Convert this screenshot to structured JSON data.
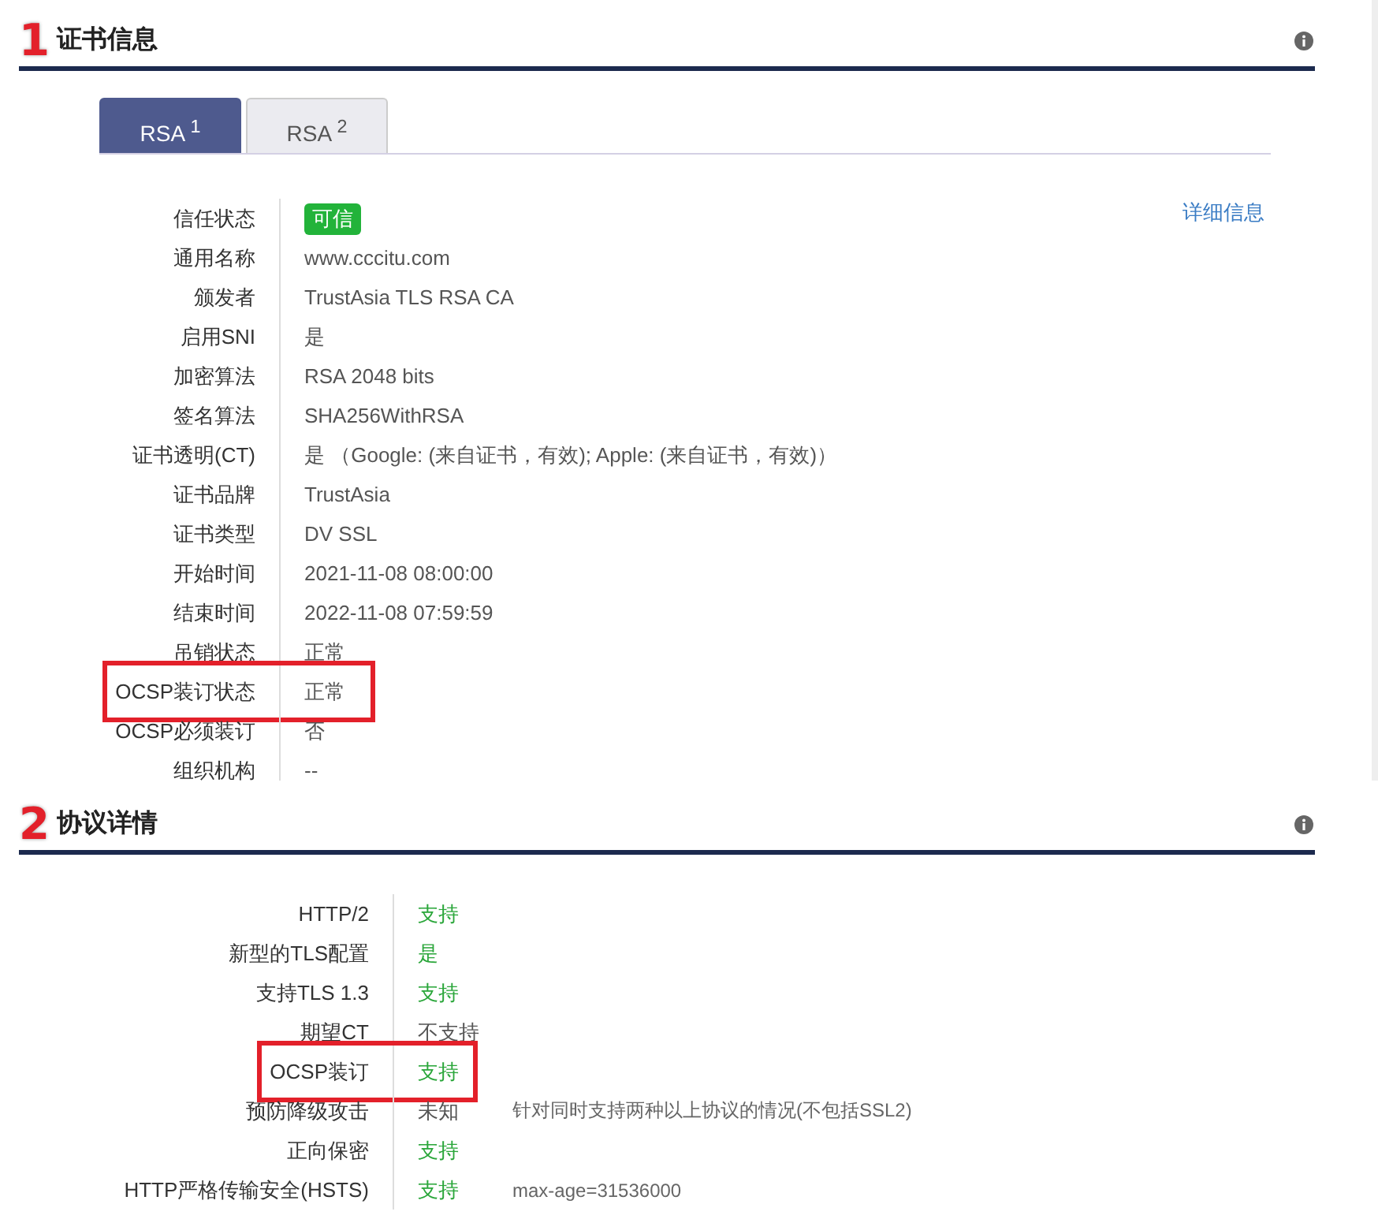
{
  "sections": [
    {
      "number": "1",
      "title": "证书信息",
      "tabs": [
        {
          "label": "RSA $^{1}$",
          "selected": true
        },
        {
          "label": "RSA $^{2}$",
          "selected": false
        }
      ],
      "link": "详细信息",
      "rows": [
        {
          "label": "信任状态",
          "value": "可信",
          "kind": "badge",
          "highlighted": false
        },
        {
          "label": "通用名称",
          "value": "www.cccitu.com",
          "kind": "plain",
          "highlighted": false
        },
        {
          "label": "颁发者",
          "value": "TrustAsia TLS RSA CA",
          "kind": "plain",
          "highlighted": false
        },
        {
          "label": "启用SNI",
          "value": "是",
          "kind": "plain",
          "highlighted": false
        },
        {
          "label": "加密算法",
          "value": "RSA 2048 bits",
          "kind": "plain",
          "highlighted": false
        },
        {
          "label": "签名算法",
          "value": "SHA256WithRSA",
          "kind": "plain",
          "highlighted": false
        },
        {
          "label": "证书透明(CT)",
          "value": "是 （Google: (来自证书，有效); Apple: (来自证书，有效)）",
          "kind": "plain",
          "highlighted": false
        },
        {
          "label": "证书品牌",
          "value": "TrustAsia",
          "kind": "plain",
          "highlighted": false
        },
        {
          "label": "证书类型",
          "value": "DV SSL",
          "kind": "plain",
          "highlighted": false
        },
        {
          "label": "开始时间",
          "value": "2021-11-08 08:00:00",
          "kind": "plain",
          "highlighted": false
        },
        {
          "label": "结束时间",
          "value": "2022-11-08 07:59:59",
          "kind": "plain",
          "highlighted": false
        },
        {
          "label": "吊销状态",
          "value": "正常",
          "kind": "plain",
          "highlighted": false
        },
        {
          "label": "OCSP装订状态",
          "value": "正常",
          "kind": "plain",
          "highlighted": true
        },
        {
          "label": "OCSP必须装订",
          "value": "否",
          "kind": "plain",
          "highlighted": false
        },
        {
          "label": "组织机构",
          "value": "--",
          "kind": "plain",
          "highlighted": false
        }
      ]
    },
    {
      "number": "2",
      "title": "协议详情",
      "rows": [
        {
          "label": "HTTP/2",
          "value": "支持",
          "kind": "good",
          "highlighted": false
        },
        {
          "label": "新型的TLS配置",
          "value": "是",
          "kind": "good",
          "highlighted": false
        },
        {
          "label": "支持TLS 1.3",
          "value": "支持",
          "kind": "good",
          "highlighted": false
        },
        {
          "label": "期望CT",
          "value": "不支持",
          "kind": "plain",
          "highlighted": false
        },
        {
          "label": "OCSP装订",
          "value": "支持",
          "kind": "good",
          "highlighted": true
        },
        {
          "label": "预防降级攻击",
          "value": "未知",
          "kind": "plain",
          "note": "针对同时支持两种以上协议的情况(不包括SSL2)",
          "highlighted": false
        },
        {
          "label": "正向保密",
          "value": "支持",
          "kind": "good",
          "highlighted": false
        },
        {
          "label": "HTTP严格传输安全(HSTS)",
          "value": "支持",
          "kind": "good",
          "note": "max-age=31536000",
          "highlighted": false
        }
      ]
    }
  ]
}
